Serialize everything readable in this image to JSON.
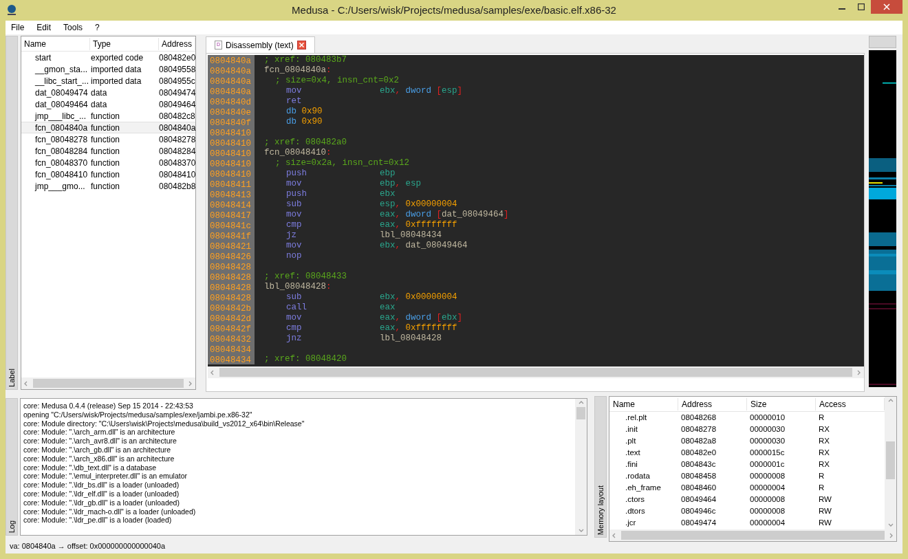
{
  "window": {
    "title": "Medusa - C:/Users/wisk/Projects/medusa/samples/exe/basic.elf.x86-32"
  },
  "menu": [
    "File",
    "Edit",
    "Tools",
    "?"
  ],
  "label_panel": {
    "dock_title": "Label",
    "columns": [
      "Name",
      "Type",
      "Address"
    ],
    "rows": [
      {
        "name": "start",
        "type": "exported code",
        "address": "080482e0",
        "selected": false
      },
      {
        "name": "__gmon_sta...",
        "type": "imported data",
        "address": "08049558",
        "selected": false
      },
      {
        "name": "__libc_start_...",
        "type": "imported data",
        "address": "0804955c",
        "selected": false
      },
      {
        "name": "dat_08049474",
        "type": "data",
        "address": "08049474",
        "selected": false
      },
      {
        "name": "dat_08049464",
        "type": "data",
        "address": "08049464",
        "selected": false
      },
      {
        "name": "jmp___libc_...",
        "type": "function",
        "address": "080482c8",
        "selected": false
      },
      {
        "name": "fcn_0804840a",
        "type": "function",
        "address": "0804840a",
        "selected": true
      },
      {
        "name": "fcn_08048278",
        "type": "function",
        "address": "08048278",
        "selected": false
      },
      {
        "name": "fcn_08048284",
        "type": "function",
        "address": "08048284",
        "selected": false
      },
      {
        "name": "fcn_08048370",
        "type": "function",
        "address": "08048370",
        "selected": false
      },
      {
        "name": "fcn_08048410",
        "type": "function",
        "address": "08048410",
        "selected": false
      },
      {
        "name": "jmp___gmo...",
        "type": "function",
        "address": "080482b8",
        "selected": false
      }
    ]
  },
  "tabs": [
    {
      "label": "Disassembly (text)",
      "selected": true,
      "icon": "D"
    }
  ],
  "disassembly": [
    {
      "address": "0804840a",
      "kind": "xref",
      "text": "; xref: 080483b7"
    },
    {
      "address": "0804840a",
      "kind": "label",
      "text": "fcn_0804840a",
      "colon": ":"
    },
    {
      "address": "0804840a",
      "kind": "info",
      "text": "; size=0x4, insn_cnt=0x2"
    },
    {
      "address": "0804840a",
      "kind": "insn",
      "mnemonic": "mov",
      "operands": [
        {
          "kind": "reg",
          "text": "ebx"
        },
        {
          "kind": "sep",
          "text": ", "
        },
        {
          "kind": "type",
          "text": "dword "
        },
        {
          "kind": "sep",
          "text": "["
        },
        {
          "kind": "reg",
          "text": "esp"
        },
        {
          "kind": "sep",
          "text": "]"
        }
      ]
    },
    {
      "address": "0804840d",
      "kind": "insn",
      "mnemonic": "ret"
    },
    {
      "address": "0804840e",
      "kind": "data",
      "mnemonic": "db",
      "value": "0x90"
    },
    {
      "address": "0804840f",
      "kind": "data",
      "mnemonic": "db",
      "value": "0x90"
    },
    {
      "address": "08048410",
      "kind": "blank"
    },
    {
      "address": "08048410",
      "kind": "xref",
      "text": "; xref: 080482a0"
    },
    {
      "address": "08048410",
      "kind": "label",
      "text": "fcn_08048410",
      "colon": ":"
    },
    {
      "address": "08048410",
      "kind": "info",
      "text": "; size=0x2a, insn_cnt=0x12"
    },
    {
      "address": "08048410",
      "kind": "insn",
      "mnemonic": "push",
      "operands": [
        {
          "kind": "reg",
          "text": "ebp"
        }
      ]
    },
    {
      "address": "08048411",
      "kind": "insn",
      "mnemonic": "mov",
      "operands": [
        {
          "kind": "reg",
          "text": "ebp"
        },
        {
          "kind": "sep",
          "text": ", "
        },
        {
          "kind": "reg",
          "text": "esp"
        }
      ]
    },
    {
      "address": "08048413",
      "kind": "insn",
      "mnemonic": "push",
      "operands": [
        {
          "kind": "reg",
          "text": "ebx"
        }
      ]
    },
    {
      "address": "08048414",
      "kind": "insn",
      "mnemonic": "sub",
      "operands": [
        {
          "kind": "reg",
          "text": "esp"
        },
        {
          "kind": "sep",
          "text": ", "
        },
        {
          "kind": "num",
          "text": "0x00000004"
        }
      ]
    },
    {
      "address": "08048417",
      "kind": "insn",
      "mnemonic": "mov",
      "operands": [
        {
          "kind": "reg",
          "text": "eax"
        },
        {
          "kind": "sep",
          "text": ", "
        },
        {
          "kind": "type",
          "text": "dword "
        },
        {
          "kind": "sep",
          "text": "["
        },
        {
          "kind": "sym",
          "text": "dat_08049464"
        },
        {
          "kind": "sep",
          "text": "]"
        }
      ]
    },
    {
      "address": "0804841c",
      "kind": "insn",
      "mnemonic": "cmp",
      "operands": [
        {
          "kind": "reg",
          "text": "eax"
        },
        {
          "kind": "sep",
          "text": ", "
        },
        {
          "kind": "num",
          "text": "0xffffffff"
        }
      ]
    },
    {
      "address": "0804841f",
      "kind": "insn",
      "mnemonic": "jz",
      "operands": [
        {
          "kind": "sym",
          "text": "lbl_08048434"
        }
      ]
    },
    {
      "address": "08048421",
      "kind": "insn",
      "mnemonic": "mov",
      "operands": [
        {
          "kind": "reg",
          "text": "ebx"
        },
        {
          "kind": "sep",
          "text": ", "
        },
        {
          "kind": "sym",
          "text": "dat_08049464"
        }
      ]
    },
    {
      "address": "08048426",
      "kind": "insn",
      "mnemonic": "nop"
    },
    {
      "address": "08048428",
      "kind": "blank"
    },
    {
      "address": "08048428",
      "kind": "xref",
      "text": "; xref: 08048433"
    },
    {
      "address": "08048428",
      "kind": "label",
      "text": "lbl_08048428",
      "colon": ":"
    },
    {
      "address": "08048428",
      "kind": "insn",
      "mnemonic": "sub",
      "operands": [
        {
          "kind": "reg",
          "text": "ebx"
        },
        {
          "kind": "sep",
          "text": ", "
        },
        {
          "kind": "num",
          "text": "0x00000004"
        }
      ]
    },
    {
      "address": "0804842b",
      "kind": "insn",
      "mnemonic": "call",
      "operands": [
        {
          "kind": "reg",
          "text": "eax"
        }
      ]
    },
    {
      "address": "0804842d",
      "kind": "insn",
      "mnemonic": "mov",
      "operands": [
        {
          "kind": "reg",
          "text": "eax"
        },
        {
          "kind": "sep",
          "text": ", "
        },
        {
          "kind": "type",
          "text": "dword "
        },
        {
          "kind": "sep",
          "text": "["
        },
        {
          "kind": "reg",
          "text": "ebx"
        },
        {
          "kind": "sep",
          "text": "]"
        }
      ]
    },
    {
      "address": "0804842f",
      "kind": "insn",
      "mnemonic": "cmp",
      "operands": [
        {
          "kind": "reg",
          "text": "eax"
        },
        {
          "kind": "sep",
          "text": ", "
        },
        {
          "kind": "num",
          "text": "0xffffffff"
        }
      ]
    },
    {
      "address": "08048432",
      "kind": "insn",
      "mnemonic": "jnz",
      "operands": [
        {
          "kind": "sym",
          "text": "lbl_08048428"
        }
      ]
    },
    {
      "address": "08048434",
      "kind": "blank"
    },
    {
      "address": "08048434",
      "kind": "xref",
      "text": "; xref: 08048420"
    }
  ],
  "log_panel": {
    "dock_title": "Log",
    "lines": [
      "core: Medusa 0.4.4 (release) Sep 15 2014 - 22:43:53",
      "opening \"C:/Users/wisk/Projects/medusa/samples/exe/jambi.pe.x86-32\"",
      "core: Module directory: \"C:\\Users\\wisk\\Projects\\medusa\\build_vs2012_x64\\bin\\Release\"",
      "core: Module: \".\\arch_arm.dll\" is an architecture",
      "core: Module: \".\\arch_avr8.dll\" is an architecture",
      "core: Module: \".\\arch_gb.dll\" is an architecture",
      "core: Module: \".\\arch_x86.dll\" is an architecture",
      "core: Module: \".\\db_text.dll\" is a database",
      "core: Module: \".\\emul_interpreter.dll\" is an emulator",
      "core: Module: \".\\ldr_bs.dll\" is a loader (unloaded)",
      "core: Module: \".\\ldr_elf.dll\" is a loader (unloaded)",
      "core: Module: \".\\ldr_gb.dll\" is a loader (unloaded)",
      "core: Module: \".\\ldr_mach-o.dll\" is a loader (unloaded)",
      "core: Module: \".\\ldr_pe.dll\" is a loader (loaded)"
    ]
  },
  "memory_panel": {
    "dock_title": "Memory layout",
    "columns": [
      "Name",
      "Address",
      "Size",
      "Access"
    ],
    "rows": [
      {
        "name": ".rel.plt",
        "address": "08048268",
        "size": "00000010",
        "access": "R"
      },
      {
        "name": ".init",
        "address": "08048278",
        "size": "00000030",
        "access": "RX"
      },
      {
        "name": ".plt",
        "address": "080482a8",
        "size": "00000030",
        "access": "RX"
      },
      {
        "name": ".text",
        "address": "080482e0",
        "size": "0000015c",
        "access": "RX"
      },
      {
        "name": ".fini",
        "address": "0804843c",
        "size": "0000001c",
        "access": "RX"
      },
      {
        "name": ".rodata",
        "address": "08048458",
        "size": "00000008",
        "access": "R"
      },
      {
        "name": ".eh_frame",
        "address": "08048460",
        "size": "00000004",
        "access": "R"
      },
      {
        "name": ".ctors",
        "address": "08049464",
        "size": "00000008",
        "access": "RW"
      },
      {
        "name": ".dtors",
        "address": "0804946c",
        "size": "00000008",
        "access": "RW"
      },
      {
        "name": ".jcr",
        "address": "08049474",
        "size": "00000004",
        "access": "RW"
      }
    ]
  },
  "status_bar": {
    "text": "va: 0804840a → offset: 0x000000000000040a"
  }
}
